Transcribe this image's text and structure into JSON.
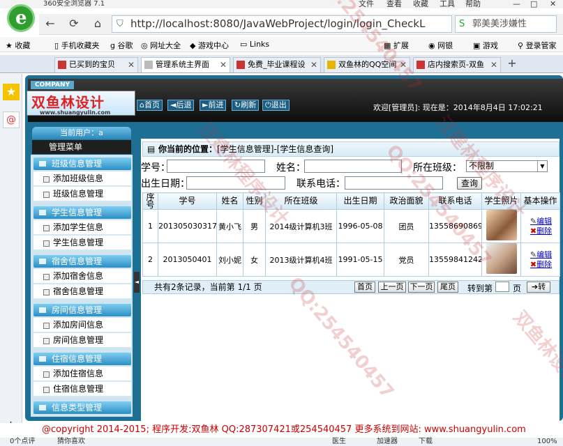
{
  "browser": {
    "title": "360安全浏览器 7.1",
    "menus": [
      "文件",
      "查看",
      "收藏",
      "工具",
      "帮助"
    ],
    "url": "http://localhost:8080/JavaWebProject/login/login_CheckL",
    "search_text": "郭美美涉嫌性"
  },
  "favorites": [
    "收藏",
    "手机收藏夹",
    "谷歌",
    "网址大全",
    "游戏中心",
    "Links",
    "扩展",
    "网银",
    "游戏",
    "登录管家"
  ],
  "tabs": [
    "已买到的宝贝",
    "管理系统主界面",
    "免费_毕业课程设",
    "双鱼林的QQ空间",
    "店内搜索页-双鱼"
  ],
  "header": {
    "company": "COMPANY",
    "logo": "双鱼林设计",
    "logo_url": "www.shuangyulin.com",
    "nav": [
      "首页",
      "后退",
      "前进",
      "刷新",
      "退出"
    ],
    "welcome": "欢迎[管理员]: 现在是：2014年8月4日 17:02:21"
  },
  "sidebar": {
    "current_user": "当前用户：a",
    "menu_title": "管理菜单",
    "sections": [
      {
        "label": "班级信息管理",
        "items": [
          "添加班级信息",
          "班级信息管理"
        ]
      },
      {
        "label": "学生信息管理",
        "items": [
          "添加学生信息",
          "学生信息管理"
        ]
      },
      {
        "label": "宿舍信息管理",
        "items": [
          "添加宿舍信息",
          "宿舍信息管理"
        ]
      },
      {
        "label": "房间信息管理",
        "items": [
          "添加房间信息",
          "房间信息管理"
        ]
      },
      {
        "label": "住宿信息管理",
        "items": [
          "添加住宿信息",
          "住宿信息管理"
        ]
      },
      {
        "label": "信息类型管理",
        "items": []
      }
    ]
  },
  "main": {
    "position_label": "你当前的位置：",
    "position": "[学生信息管理]-[学生信息查询]",
    "form": {
      "student_no": "学号：",
      "name": "姓名：",
      "class": "所在班级：",
      "class_value": "不限制",
      "birth": "出生日期：",
      "phone": "联系电话：",
      "query": "查询"
    },
    "columns": [
      "序号",
      "学号",
      "姓名",
      "性别",
      "所在班级",
      "出生日期",
      "政治面貌",
      "联系电话",
      "学生照片",
      "基本操作"
    ],
    "rows": [
      [
        "1",
        "201305030317",
        "黄小飞",
        "男",
        "2014级计算机3班",
        "1996-05-08",
        "团员",
        "13558690869"
      ],
      [
        "2",
        "2013050401",
        "刘小妮",
        "女",
        "2013级计算机4班",
        "1991-05-15",
        "党员",
        "13559841242"
      ]
    ],
    "edit": "编辑",
    "delete": "删除",
    "footer": "共有2条记录，当前第 1/1 页",
    "pager": [
      "首页",
      "上一页",
      "下一页",
      "尾页"
    ],
    "goto": "转到第",
    "page": "页",
    "go": "转"
  },
  "copyright": "@copyright 2014-2015; 程序开发:双鱼林  QQ:287307421或254540457  更多系统到网站: www.shuangyulin.com",
  "status": {
    "left": "0个点评",
    "guess": "猜你喜欢",
    "doctor": "医生",
    "accel": "加速器",
    "download": "下载",
    "zoom": "100%"
  },
  "watermark": [
    "QQ:254540457",
    "汪建林程序设计",
    "双鱼林设计"
  ]
}
